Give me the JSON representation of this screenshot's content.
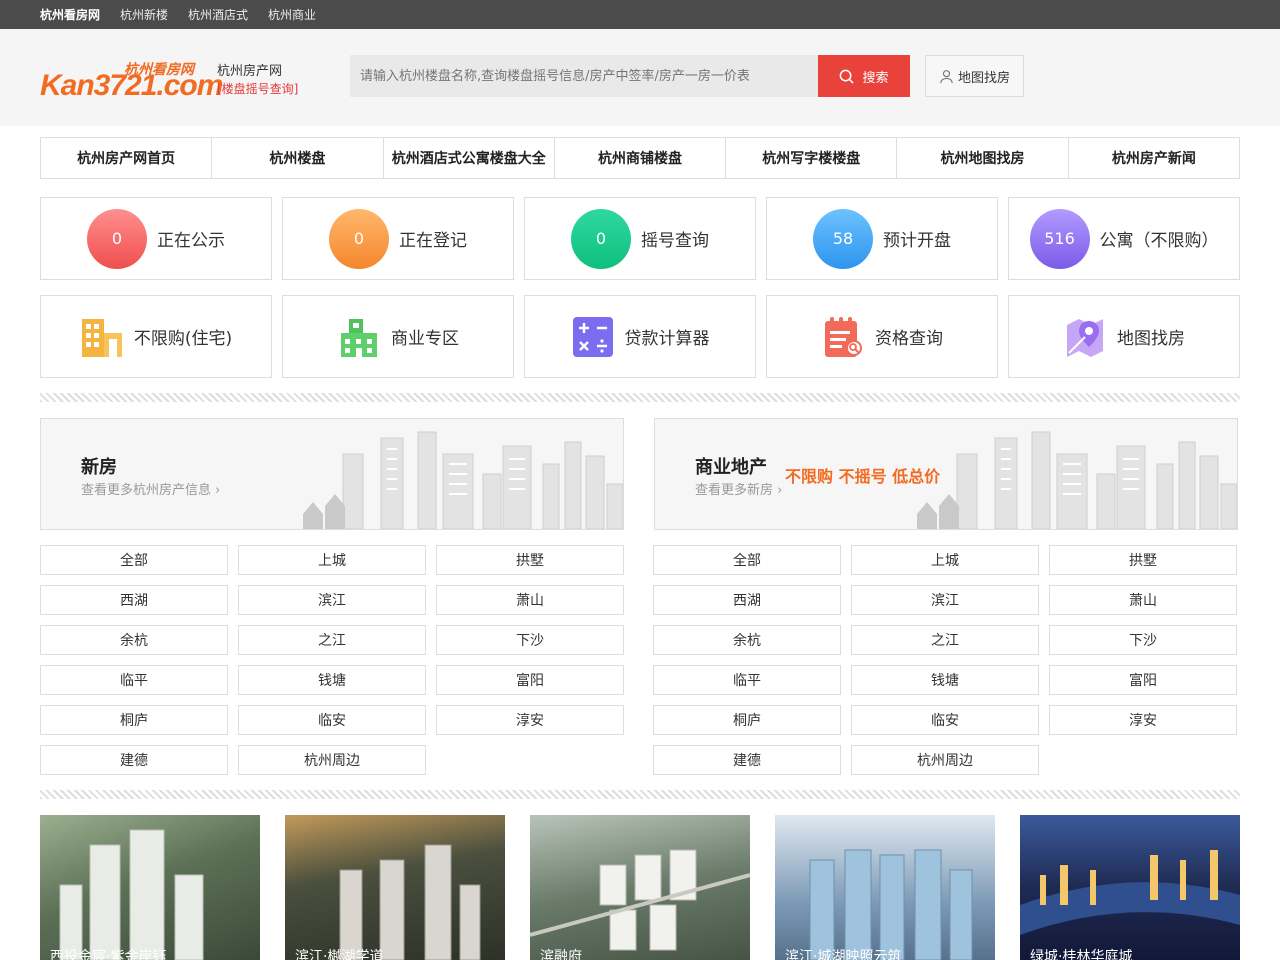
{
  "topbar": {
    "links": [
      "杭州看房网",
      "杭州新楼",
      "杭州酒店式",
      "杭州商业"
    ]
  },
  "header": {
    "logo_en": "Kan3721.com",
    "logo_cn": "杭州看房网",
    "site_name": "杭州房产网",
    "site_sub": "[楼盘摇号查询]",
    "search_placeholder": "请输入杭州楼盘名称,查询楼盘摇号信息/房产中签率/房产一房一价表",
    "search_label": "搜索",
    "map_label": "地图找房"
  },
  "nav": [
    "杭州房产网首页",
    "杭州楼盘",
    "杭州酒店式公寓楼盘大全",
    "杭州商铺楼盘",
    "杭州写字楼楼盘",
    "杭州地图找房",
    "杭州房产新闻"
  ],
  "stats": [
    {
      "count": "0",
      "label": "正在公示",
      "color": "#f05a5a"
    },
    {
      "count": "0",
      "label": "正在登记",
      "color": "#f7913a"
    },
    {
      "count": "0",
      "label": "摇号查询",
      "color": "#1ac98a"
    },
    {
      "count": "58",
      "label": "预计开盘",
      "color": "#3ba5f2"
    },
    {
      "count": "516",
      "label": "公寓（不限购）",
      "color": "#8f6cf0"
    }
  ],
  "tools": [
    {
      "label": "不限购(住宅)",
      "icon": "building-icon",
      "color": "#f5b33f"
    },
    {
      "label": "商业专区",
      "icon": "office-icon",
      "color": "#4fc25b"
    },
    {
      "label": "贷款计算器",
      "icon": "calculator-icon",
      "color": "#7b6cf0"
    },
    {
      "label": "资格查询",
      "icon": "checklist-icon",
      "color": "#f26b5a"
    },
    {
      "label": "地图找房",
      "icon": "map-pin-icon",
      "color": "#b28af0"
    }
  ],
  "section_new": {
    "title": "新房",
    "sub": "查看更多杭州房产信息"
  },
  "section_commercial": {
    "title": "商业地产",
    "sub": "查看更多新房",
    "promo": "不限购 不摇号 低总价"
  },
  "districts_new": [
    "全部",
    "上城",
    "拱墅",
    "西湖",
    "滨江",
    "萧山",
    "余杭",
    "之江",
    "下沙",
    "临平",
    "钱塘",
    "富阳",
    "桐庐",
    "临安",
    "淳安",
    "建德",
    "杭州周边"
  ],
  "districts_commercial": [
    "全部",
    "上城",
    "拱墅",
    "西湖",
    "滨江",
    "萧山",
    "余杭",
    "之江",
    "下沙",
    "临平",
    "钱塘",
    "富阳",
    "桐庐",
    "临安",
    "淳安",
    "建德",
    "杭州周边"
  ],
  "photos": [
    {
      "caption": "西投金宸·紫金岸钰",
      "bg": "#5d7157"
    },
    {
      "caption": "滨江·樾湖学道",
      "bg": "#4a4f3e"
    },
    {
      "caption": "滨融府",
      "bg": "#6a7b6a"
    },
    {
      "caption": "滨江·城湖映照云筑",
      "bg": "#7d9bb7"
    },
    {
      "caption": "绿城·桂林华庭城",
      "bg": "#1f2a52"
    }
  ]
}
